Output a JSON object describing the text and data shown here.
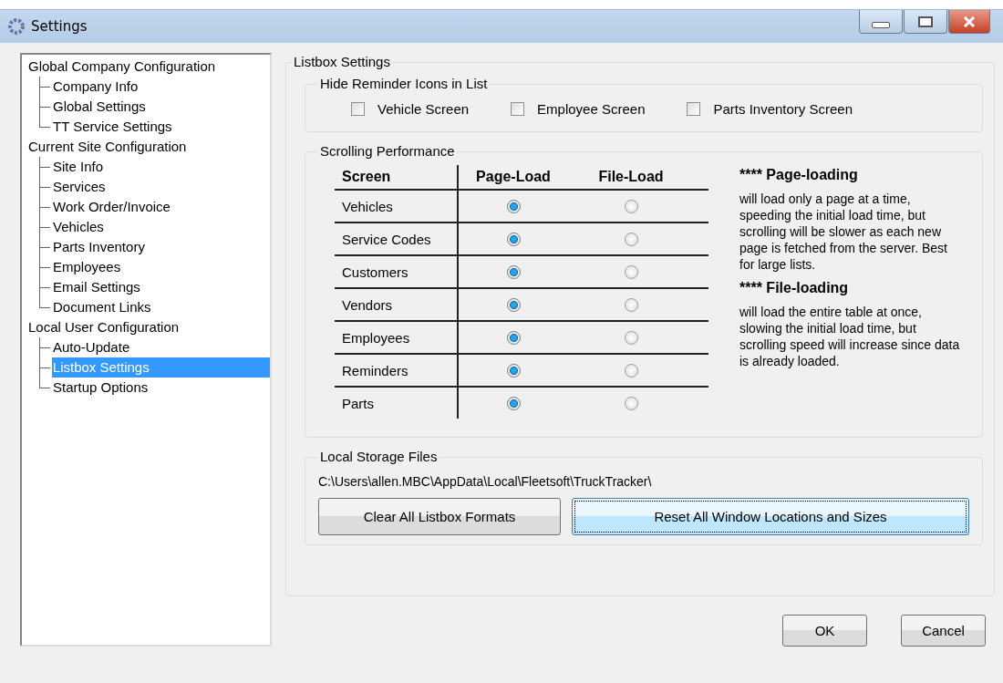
{
  "window": {
    "title": "Settings"
  },
  "tree": [
    {
      "label": "Global Company Configuration",
      "selected": false,
      "children": [
        {
          "label": "Company Info",
          "selected": false
        },
        {
          "label": "Global Settings",
          "selected": false
        },
        {
          "label": "TT Service Settings",
          "selected": false
        }
      ]
    },
    {
      "label": "Current Site Configuration",
      "selected": false,
      "children": [
        {
          "label": "Site Info",
          "selected": false
        },
        {
          "label": "Services",
          "selected": false
        },
        {
          "label": "Work Order/Invoice",
          "selected": false
        },
        {
          "label": "Vehicles",
          "selected": false
        },
        {
          "label": "Parts Inventory",
          "selected": false
        },
        {
          "label": "Employees",
          "selected": false
        },
        {
          "label": "Email Settings",
          "selected": false
        },
        {
          "label": "Document Links",
          "selected": false
        }
      ]
    },
    {
      "label": "Local User Configuration",
      "selected": false,
      "children": [
        {
          "label": "Auto-Update",
          "selected": false
        },
        {
          "label": "Listbox Settings",
          "selected": true
        },
        {
          "label": "Startup Options",
          "selected": false
        }
      ]
    }
  ],
  "panel": {
    "title": "Listbox Settings",
    "hide_icons": {
      "title": "Hide Reminder Icons in List",
      "options": [
        {
          "label": "Vehicle Screen",
          "checked": false
        },
        {
          "label": "Employee Screen",
          "checked": false
        },
        {
          "label": "Parts Inventory Screen",
          "checked": false
        }
      ]
    },
    "scrolling": {
      "title": "Scrolling Performance",
      "columns": [
        "Screen",
        "Page-Load",
        "File-Load"
      ],
      "rows": [
        {
          "screen": "Vehicles",
          "page_load": true,
          "file_load": false
        },
        {
          "screen": "Service Codes",
          "page_load": true,
          "file_load": false
        },
        {
          "screen": "Customers",
          "page_load": true,
          "file_load": false
        },
        {
          "screen": "Vendors",
          "page_load": true,
          "file_load": false
        },
        {
          "screen": "Employees",
          "page_load": true,
          "file_load": false
        },
        {
          "screen": "Reminders",
          "page_load": true,
          "file_load": false
        },
        {
          "screen": "Parts",
          "page_load": true,
          "file_load": false
        }
      ],
      "notes": [
        {
          "heading": "**** Page-loading",
          "text": "will load only a page at a time, speeding the initial load time, but scrolling will be slower as each new page is fetched from the server.  Best for large lists."
        },
        {
          "heading": "**** File-loading",
          "text": "will load the entire table at once, slowing the initial load time, but scrolling speed will increase since data is already loaded."
        }
      ]
    },
    "storage": {
      "title": "Local Storage Files",
      "path": "C:\\Users\\allen.MBC\\AppData\\Local\\Fleetsoft\\TruckTracker\\",
      "buttons": [
        {
          "label": "Clear All Listbox Formats",
          "focused": false
        },
        {
          "label": "Reset All Window Locations and Sizes",
          "focused": true
        }
      ]
    }
  },
  "buttons": [
    "OK",
    "Cancel"
  ]
}
